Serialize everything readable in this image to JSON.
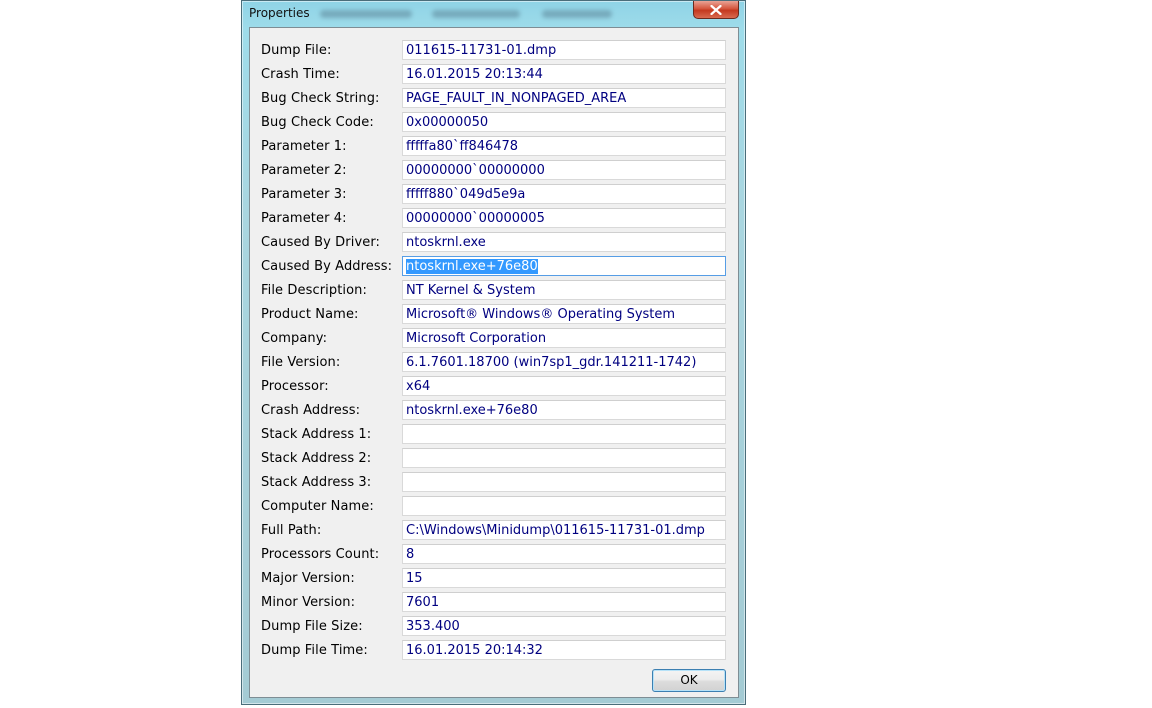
{
  "window": {
    "title": "Properties",
    "ok_label": "OK"
  },
  "fields": [
    {
      "label": "Dump File:",
      "value": "011615-11731-01.dmp"
    },
    {
      "label": "Crash Time:",
      "value": "16.01.2015 20:13:44"
    },
    {
      "label": "Bug Check String:",
      "value": "PAGE_FAULT_IN_NONPAGED_AREA"
    },
    {
      "label": "Bug Check Code:",
      "value": "0x00000050"
    },
    {
      "label": "Parameter 1:",
      "value": "fffffa80`ff846478"
    },
    {
      "label": "Parameter 2:",
      "value": "00000000`00000000"
    },
    {
      "label": "Parameter 3:",
      "value": "fffff880`049d5e9a"
    },
    {
      "label": "Parameter 4:",
      "value": "00000000`00000005"
    },
    {
      "label": "Caused By Driver:",
      "value": "ntoskrnl.exe"
    },
    {
      "label": "Caused By Address:",
      "value": "ntoskrnl.exe+76e80"
    },
    {
      "label": "File Description:",
      "value": "NT Kernel & System"
    },
    {
      "label": "Product Name:",
      "value": "Microsoft® Windows® Operating System"
    },
    {
      "label": "Company:",
      "value": "Microsoft Corporation"
    },
    {
      "label": "File Version:",
      "value": "6.1.7601.18700 (win7sp1_gdr.141211-1742)"
    },
    {
      "label": "Processor:",
      "value": "x64"
    },
    {
      "label": "Crash Address:",
      "value": "ntoskrnl.exe+76e80"
    },
    {
      "label": "Stack Address 1:",
      "value": ""
    },
    {
      "label": "Stack Address 2:",
      "value": ""
    },
    {
      "label": "Stack Address 3:",
      "value": ""
    },
    {
      "label": "Computer Name:",
      "value": ""
    },
    {
      "label": "Full Path:",
      "value": "C:\\Windows\\Minidump\\011615-11731-01.dmp"
    },
    {
      "label": "Processors Count:",
      "value": "8"
    },
    {
      "label": "Major Version:",
      "value": "15"
    },
    {
      "label": "Minor Version:",
      "value": "7601"
    },
    {
      "label": "Dump File Size:",
      "value": "353.400"
    },
    {
      "label": "Dump File Time:",
      "value": "16.01.2015 20:14:32"
    }
  ],
  "selected_field": "Caused By Address:",
  "colors": {
    "value_text": "#000080",
    "selection": "#3399ff",
    "close_button": "#c4391f"
  }
}
